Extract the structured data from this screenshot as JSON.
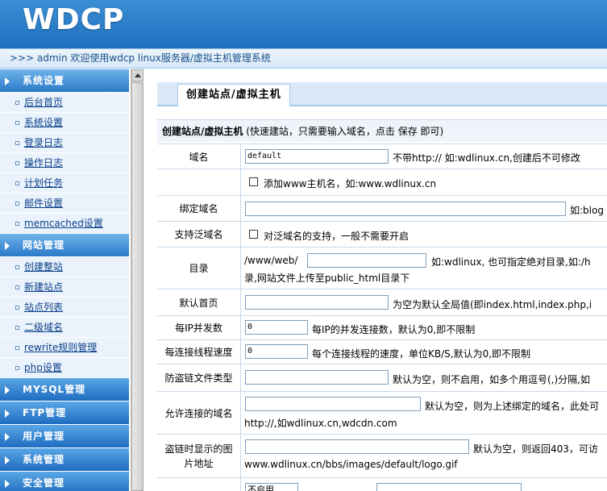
{
  "header": {
    "logo": "WDCP"
  },
  "welcome": {
    "text": ">>> admin 欢迎使用wdcp linux服务器/虚拟主机管理系统"
  },
  "sidebar": {
    "sections": [
      {
        "title": "系统设置",
        "open": true,
        "items": [
          "后台首页",
          "系统设置",
          "登录日志",
          "操作日志",
          "计划任务",
          "邮件设置",
          "memcached设置"
        ]
      },
      {
        "title": "网站管理",
        "open": true,
        "items": [
          "创建整站",
          "新建站点",
          "站点列表",
          "二级域名",
          "rewrite规则管理",
          "php设置"
        ]
      },
      {
        "title": "MYSQL管理",
        "open": false,
        "items": []
      },
      {
        "title": "FTP管理",
        "open": false,
        "items": []
      },
      {
        "title": "用户管理",
        "open": false,
        "items": []
      },
      {
        "title": "系统管理",
        "open": false,
        "items": []
      },
      {
        "title": "安全管理",
        "open": false,
        "items": []
      }
    ]
  },
  "main": {
    "tab": "创建站点/虚拟主机",
    "form_title": "创建站点/虚拟主机",
    "form_subtitle": "(快速建站，只需要输入域名，点击 保存 即可)",
    "rows": {
      "domain": {
        "label": "域名",
        "value": "default",
        "hint": "不带http:// 如:wdlinux.cn,创建后不可修改"
      },
      "www": {
        "hint": "添加www主机名，如:www.wdlinux.cn"
      },
      "bind": {
        "label": "绑定域名",
        "hint": "如:blog"
      },
      "wildcard": {
        "label": "支持泛域名",
        "hint": "对泛域名的支持，一般不需要开启"
      },
      "dir": {
        "label": "目录",
        "prefix": "/www/web/",
        "hint": "如:wdlinux, 也可指定绝对目录,如:/h",
        "hint2": "录,网站文件上传至public_html目录下"
      },
      "index": {
        "label": "默认首页",
        "hint": "为空为默认全局值(即index.html,index.php,i"
      },
      "perip": {
        "label": "每IP并发数",
        "value": "0",
        "hint": "每IP的并发连接数，默认为0,即不限制"
      },
      "rate": {
        "label": "每连接线程速度",
        "value": "0",
        "hint": "每个连接线程的速度，单位KB/S,默认为0,即不限制"
      },
      "hotlink": {
        "label": "防盗链文件类型",
        "hint": "默认为空，则不启用，如多个用逗号(,)分隔,如"
      },
      "allow": {
        "label": "允许连接的域名",
        "hint": "默认为空，则为上述绑定的域名，此处可",
        "hint2": "http://,如wdlinux.cn,wdcdn.com"
      },
      "image": {
        "label_line1": "盗链时显示的图",
        "label_line2": "片地址",
        "hint": "默认为空，则返回403，可访",
        "hint2": "www.wdlinux.cn/bbs/images/default/logo.gif"
      },
      "last": {
        "select": "不启用"
      }
    }
  }
}
